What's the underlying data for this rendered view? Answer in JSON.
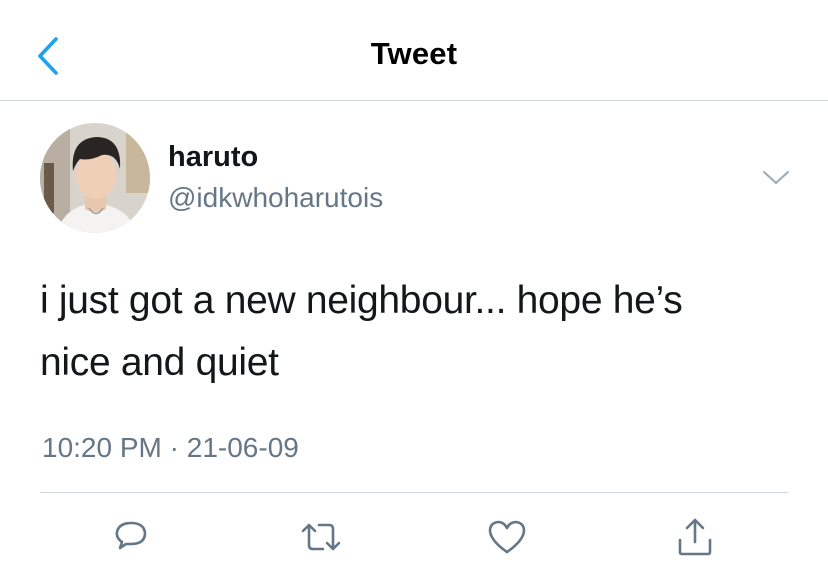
{
  "header": {
    "title": "Tweet",
    "back_icon": "chevron-left-icon",
    "accent_color": "#1da1f2"
  },
  "tweet": {
    "author": {
      "display_name": "haruto",
      "handle": "@idkwhoharutois"
    },
    "text_line_1": "i just got a new neighbour... hope he’s",
    "text_line_2": "nice and quiet",
    "time": "10:20 PM",
    "separator": "·",
    "date": "21-06-09"
  },
  "actions": {
    "icons": [
      "reply-icon",
      "retweet-icon",
      "like-icon",
      "share-icon"
    ],
    "icon_color": "#657786"
  }
}
